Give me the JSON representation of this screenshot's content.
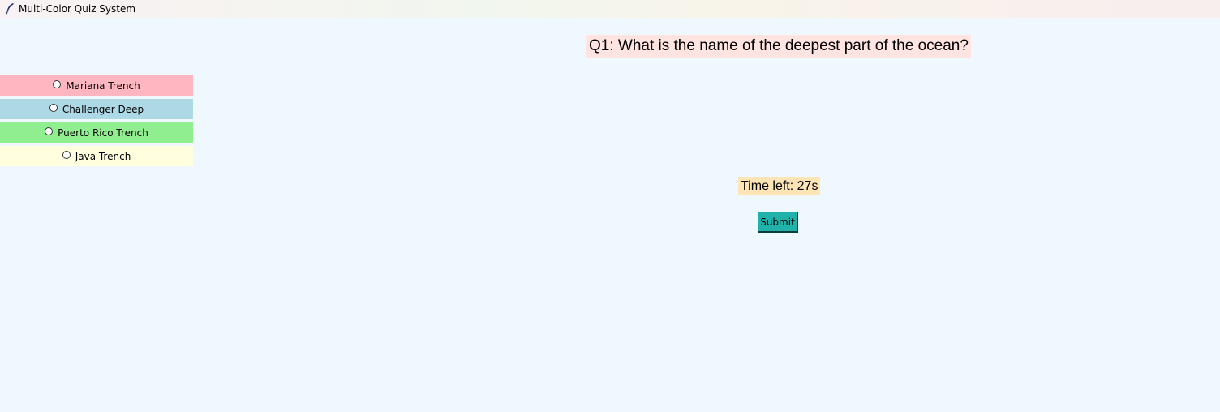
{
  "window": {
    "title": "Multi-Color Quiz System",
    "icon": "feather-icon"
  },
  "quiz": {
    "question": "Q1: What is the name of the deepest part of the ocean?",
    "options": [
      {
        "label": "Mariana Trench",
        "color": "#ffb6c1"
      },
      {
        "label": "Challenger Deep",
        "color": "#add8e6"
      },
      {
        "label": "Puerto Rico Trench",
        "color": "#90ee90"
      },
      {
        "label": "Java Trench",
        "color": "#ffffe0"
      }
    ],
    "timer": "Time left: 27s",
    "submit_label": "Submit"
  },
  "colors": {
    "background": "#f0f8ff",
    "question_bg": "#ffe4e1",
    "timer_bg": "#ffe4b5",
    "submit_bg": "#20b2aa"
  }
}
